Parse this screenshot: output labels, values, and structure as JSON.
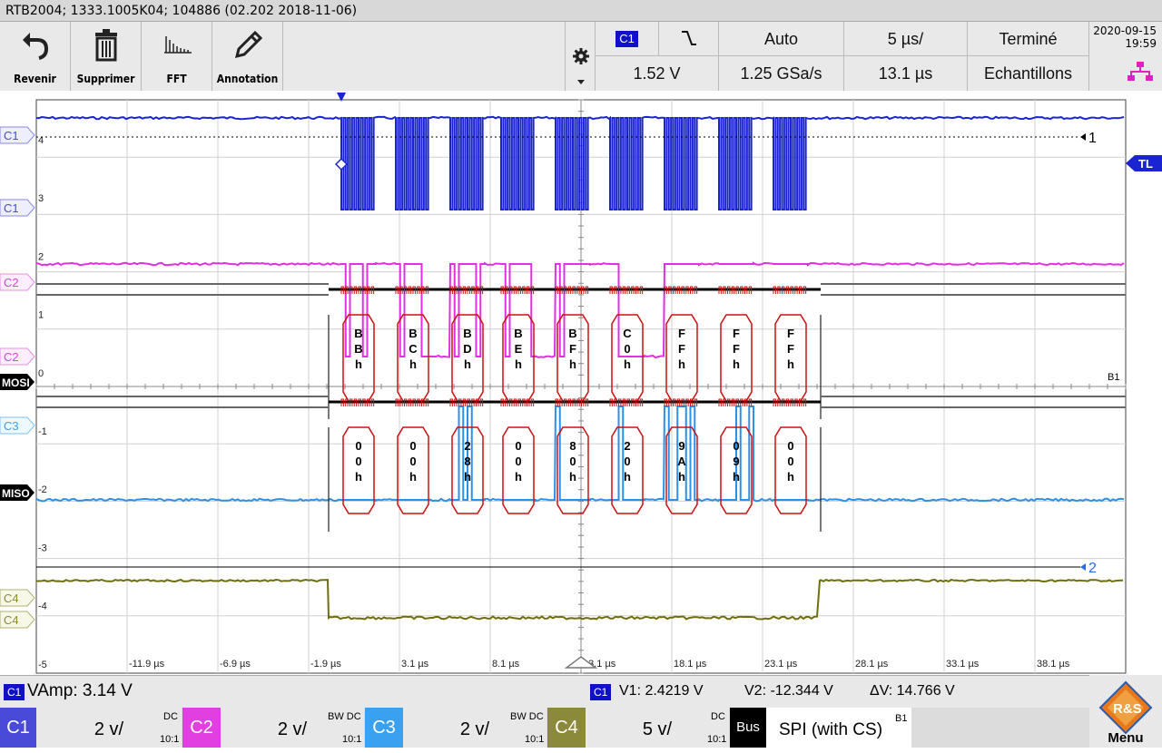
{
  "title": "RTB2004; 1333.1005K04; 104886 (02.202 2018-11-06)",
  "toolbar": {
    "undo_label": "Revenir",
    "delete_label": "Supprimer",
    "fft_label": "FFT",
    "annotation_label": "Annotation"
  },
  "trigger": {
    "source": "C1",
    "slope_icon": "falling-edge",
    "mode": "Auto",
    "timebase": "5 µs/",
    "state": "Terminé",
    "level": "1.52 V",
    "sample_rate": "1.25 GSa/s",
    "position": "13.1 µs",
    "acq_mode": "Echantillons"
  },
  "datetime": {
    "date": "2020-09-15",
    "time": "19:59"
  },
  "grid": {
    "y_labels": [
      "4",
      "3",
      "2",
      "1",
      "0",
      "-1",
      "-2",
      "-3",
      "-4",
      "-5"
    ],
    "x_labels": [
      "-11.9 µs",
      "-6.9 µs",
      "-1.9 µs",
      "3.1 µs",
      "8.1 µs",
      "13.1 µs",
      "18.1 µs",
      "23.1 µs",
      "28.1 µs",
      "33.1 µs",
      "38.1 µs"
    ]
  },
  "markers": {
    "c1_thresh": "C1",
    "c1": "C1",
    "c2_thresh": "C2",
    "c2": "C2",
    "mosi": "MOSI",
    "c3_thresh": "C3",
    "miso": "MISO",
    "c4_thresh": "C4",
    "c4": "C4",
    "cursor1": "1",
    "cursor2": "2",
    "tl": "TL",
    "bus": "B1"
  },
  "bus_decode": {
    "mosi": [
      "BBh",
      "BCh",
      "BDh",
      "BEh",
      "BFh",
      "C0h",
      "FFh",
      "FFh",
      "FFh"
    ],
    "miso": [
      "00h",
      "00h",
      "28h",
      "00h",
      "80h",
      "20h",
      "9Ah",
      "09h",
      "00h"
    ]
  },
  "measure": {
    "vamp_channel": "C1",
    "vamp": "VAmp: 3.14 V",
    "cursor_channel": "C1",
    "v1": "V1: 2.4219 V",
    "v2": "V2: -12.344 V",
    "dv": "ΔV: 14.766 V"
  },
  "channels": [
    {
      "name": "C1",
      "scale": "2 v/",
      "coupling": "DC",
      "probe": "10:1",
      "color": "#4a4ad8"
    },
    {
      "name": "C2",
      "scale": "2 v/",
      "coupling": "BW DC",
      "probe": "10:1",
      "color": "#e040e0"
    },
    {
      "name": "C3",
      "scale": "2 v/",
      "coupling": "BW DC",
      "probe": "10:1",
      "color": "#3aa0f0"
    },
    {
      "name": "C4",
      "scale": "5 v/",
      "coupling": "DC",
      "probe": "10:1",
      "color": "#8a8a3a"
    }
  ],
  "bus": {
    "label": "Bus",
    "protocol": "SPI (with CS)",
    "id": "B1"
  },
  "menu_label": "Menu",
  "logo_text": "R&S",
  "colors": {
    "c1": "#1a24d0",
    "c2": "#e030e0",
    "c3": "#2a90e8",
    "c4": "#6e6e10",
    "bus_frame": "#cc1010"
  }
}
